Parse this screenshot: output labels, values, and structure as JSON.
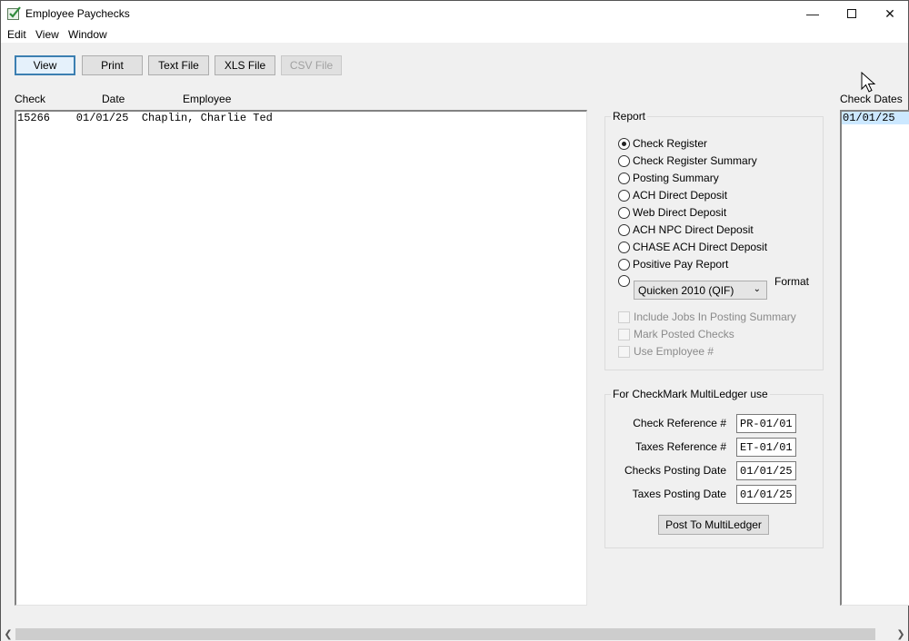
{
  "window": {
    "title": "Employee Paychecks",
    "minimize_icon": "minimize-icon",
    "maximize_icon": "maximize-icon",
    "close_icon": "close-icon"
  },
  "menu": [
    "Edit",
    "View",
    "Window"
  ],
  "toolbar": {
    "view": "View",
    "print": "Print",
    "text_file": "Text File",
    "xls_file": "XLS File",
    "csv_file": "CSV File"
  },
  "checks_list": {
    "headers": [
      "Check",
      "Date",
      "Employee"
    ],
    "rows": [
      {
        "check": "15266",
        "date": "01/01/25",
        "employee": "Chaplin, Charlie Ted",
        "text": "15266    01/01/25  Chaplin, Charlie Ted"
      }
    ]
  },
  "report": {
    "title": "Report",
    "options": [
      {
        "label": "Check Register",
        "checked": true
      },
      {
        "label": "Check Register Summary",
        "checked": false
      },
      {
        "label": "Posting Summary",
        "checked": false
      },
      {
        "label": "ACH Direct Deposit",
        "checked": false
      },
      {
        "label": "Web Direct Deposit",
        "checked": false
      },
      {
        "label": "ACH NPC Direct Deposit",
        "checked": false
      },
      {
        "label": "CHASE ACH Direct Deposit",
        "checked": false
      },
      {
        "label": "Positive Pay Report",
        "checked": false
      }
    ],
    "format_select": "Quicken 2010 (QIF)",
    "format_label": "Format",
    "checkboxes": [
      {
        "label": "Include Jobs In Posting Summary",
        "checked": false,
        "disabled": true
      },
      {
        "label": "Mark Posted Checks",
        "checked": false,
        "disabled": true
      },
      {
        "label": "Use Employee #",
        "checked": false,
        "disabled": true
      }
    ]
  },
  "multiledger": {
    "title": "For CheckMark MultiLedger use",
    "fields": [
      {
        "label": "Check Reference #",
        "value": "PR-01/01"
      },
      {
        "label": "Taxes Reference #",
        "value": "ET-01/01"
      },
      {
        "label": "Checks Posting Date",
        "value": "01/01/25"
      },
      {
        "label": "Taxes Posting Date",
        "value": "01/01/25"
      }
    ],
    "post_button": "Post To MultiLedger"
  },
  "check_dates": {
    "header": "Check Dates",
    "items": [
      "01/01/25"
    ]
  }
}
